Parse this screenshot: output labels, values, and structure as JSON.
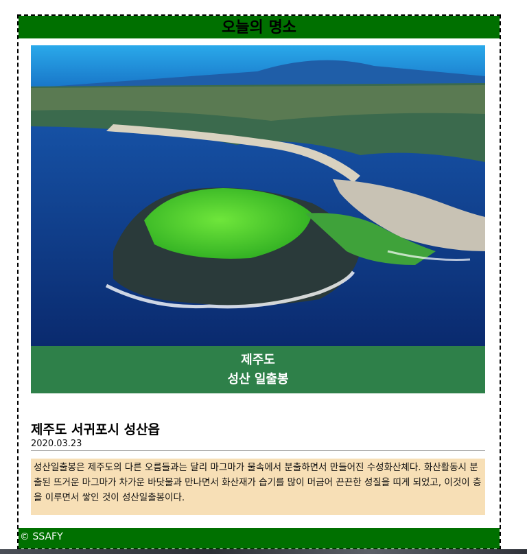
{
  "header": {
    "title": "오늘의 명소"
  },
  "photo": {
    "subject": "island-crater-photo"
  },
  "caption": {
    "line1": "제주도",
    "line2": "성산 일출봉"
  },
  "article": {
    "address": "제주도 서귀포시 성산읍",
    "date": "2020.03.23",
    "description": "성산일출봉은 제주도의 다른 오름들과는 달리 마그마가 물속에서 분출하면서 만들어진 수성화산체다. 화산활동시 분출된 뜨거운 마그마가 차가운 바닷물과 만나면서 화산재가 습기를 많이 머금어 끈끈한 성질을 띠게 되었고, 이것이 층을 이루면서 쌓인 것이 성산일출봉이다."
  },
  "footer": {
    "text": "© SSAFY"
  },
  "colors": {
    "header_bg": "#007000",
    "caption_bg": "#2e8049",
    "desc_bg": "#f7dfb6"
  }
}
